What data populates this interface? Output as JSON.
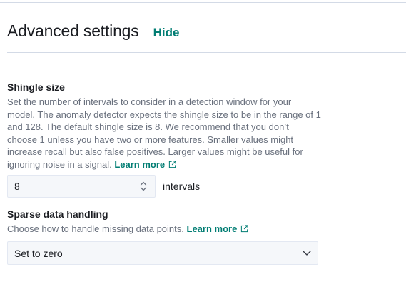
{
  "header": {
    "title": "Advanced settings",
    "hide_label": "Hide"
  },
  "shingle": {
    "title": "Shingle size",
    "help_text": "Set the number of intervals to consider in a detection window for your model. The anomaly detector expects the shingle size to be in the range of 1 and 128. The default shingle size is 8. We recommend that you don’t choose 1 unless you have two or more features. Smaller values might increase recall but also false positives. Larger values might be useful for ignoring noise in a signal.",
    "learn_more": "Learn more",
    "value": "8",
    "unit": "intervals"
  },
  "sparse": {
    "title": "Sparse data handling",
    "help_text": "Choose how to handle missing data points.",
    "learn_more": "Learn more",
    "selected": "Set to zero"
  },
  "colors": {
    "link": "#017d73",
    "text": "#343741",
    "muted": "#69707d",
    "field_bg": "#f5f7fa",
    "border": "#d3dae6"
  },
  "icons": {
    "external": "external-link-icon",
    "stepper": "stepper-icon",
    "chevron": "chevron-down-icon"
  }
}
